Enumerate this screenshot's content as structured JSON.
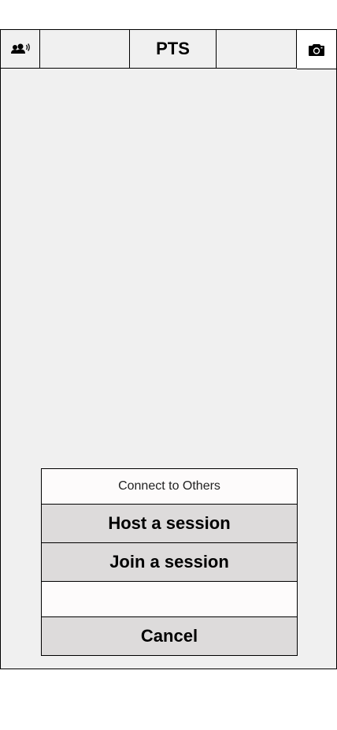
{
  "header": {
    "title": "PTS",
    "left_icon": "peers-broadcast-icon",
    "right_icon": "camera-icon"
  },
  "dialog": {
    "title": "Connect to Others",
    "host_label": "Host a session",
    "join_label": "Join a session",
    "input_value": "",
    "cancel_label": "Cancel"
  }
}
